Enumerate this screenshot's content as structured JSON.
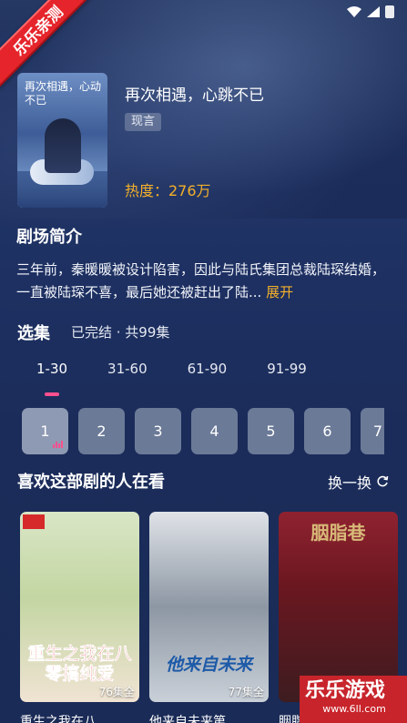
{
  "ribbon": "乐乐亲测",
  "drama": {
    "poster_title": "再次相遇，心动不已",
    "title": "再次相遇，心跳不已",
    "tag": "现言",
    "heat": "热度：276万"
  },
  "intro": {
    "heading": "剧场简介",
    "text": "三年前，秦暖暖被设计陷害，因此与陆氏集团总裁陆琛结婚，一直被陆琛不喜，最后她还被赶出了陆...",
    "more": "展开"
  },
  "episodes": {
    "heading": "选集",
    "status": "已完结 · 共99集",
    "tabs": [
      "1-30",
      "31-60",
      "61-90",
      "91-99"
    ],
    "items": [
      "1",
      "2",
      "3",
      "4",
      "5",
      "6",
      "7"
    ]
  },
  "recommend": {
    "heading": "喜欢这部剧的人在看",
    "refresh": "换一换",
    "cards": [
      {
        "cover_text": "重生之我在八零搞纯爱",
        "count": "76集全",
        "name": "重生之我在八..."
      },
      {
        "cover_text": "他来自未来",
        "count": "77集全",
        "name": "他来自未来第..."
      },
      {
        "cover_text": "胭脂巷",
        "count": "",
        "name": "胭脂巷"
      }
    ]
  },
  "watermark": {
    "main": "乐乐游戏",
    "url": "www.6ll.com"
  },
  "colors": {
    "accent_orange": "#f4b02a",
    "accent_pink": "#ff4f8e",
    "ribbon_red": "#e5252b"
  }
}
